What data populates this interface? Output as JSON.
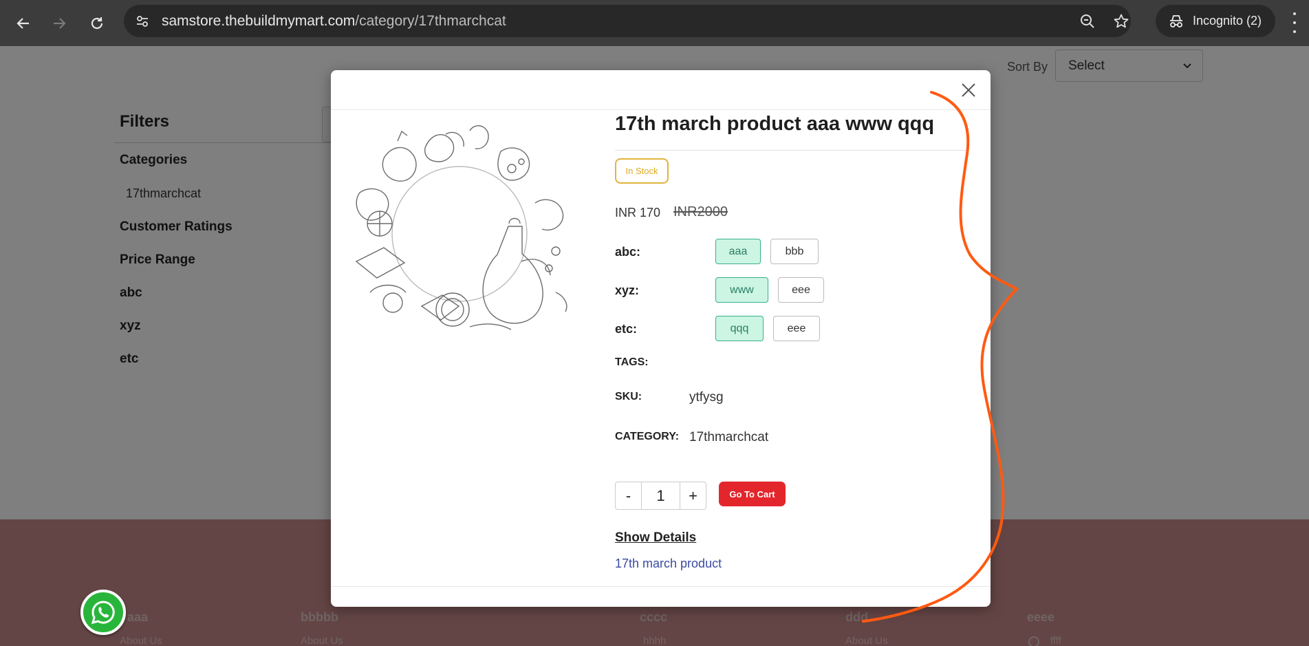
{
  "browser": {
    "url_host": "samstore.thebuildmymart.com",
    "url_path": "/category/17thmarchcat",
    "incognito_label": "Incognito (2)"
  },
  "page": {
    "sort_label": "Sort By",
    "sort_value": "Select",
    "filters_title": "Filters",
    "filters": {
      "categories": "Categories",
      "category_item": "17thmarchcat",
      "customer_ratings": "Customer Ratings",
      "price_range": "Price Range",
      "abc": "abc",
      "xyz": "xyz",
      "etc": "etc"
    },
    "footer": {
      "col1_title": "aaa",
      "col2_title": "bbbbb",
      "col3_title": "cccc",
      "col4_title": "ddd",
      "col5_title": "eeee",
      "col1_link": "About Us",
      "col2_link": "About Us",
      "col3_link": "hhhh",
      "col4_link": "About Us",
      "col5_link": "ffff"
    }
  },
  "modal": {
    "title": "17th march product aaa www qqq",
    "stock": "In Stock",
    "price": "INR 170",
    "old_price": "INR2000",
    "options": [
      {
        "label": "abc:",
        "values": [
          "aaa",
          "bbb"
        ]
      },
      {
        "label": "xyz:",
        "values": [
          "www",
          "eee"
        ]
      },
      {
        "label": "etc:",
        "values": [
          "qqq",
          "eee"
        ]
      }
    ],
    "tags_label": "TAGS:",
    "sku_label": "SKU:",
    "sku_value": "ytfysg",
    "category_label": "CATEGORY:",
    "category_value": "17thmarchcat",
    "qty_minus": "-",
    "qty_value": "1",
    "qty_plus": "+",
    "cart_button": "Go To Cart",
    "show_details": "Show Details",
    "short_description": "17th march product"
  },
  "colors": {
    "accent_red": "#e3262c",
    "selected_option_bg": "#ccf5e4",
    "stock_badge": "#e0a91f",
    "annotation_stroke": "#ff5a12"
  }
}
